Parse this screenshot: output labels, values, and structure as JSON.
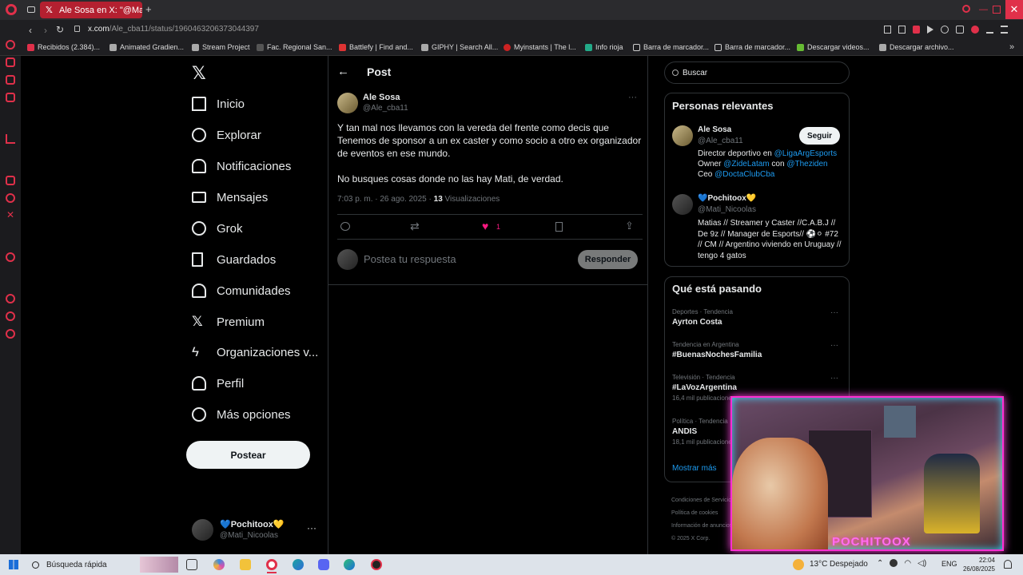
{
  "browser": {
    "tab_title": "Ale Sosa en X: \"@Mati_Ni...",
    "url_prefix": "x.com",
    "url_path": "/Ale_cba11/status/1960463206373044397",
    "bookmarks": [
      "Recibidos (2.384)...",
      "Animated Gradien...",
      "Stream Project",
      "Fac. Regional San...",
      "Battlefy | Find and...",
      "GIPHY | Search All...",
      "Myinstants | The l...",
      "Info rioja",
      "Barra de marcador...",
      "Barra de marcador...",
      "Descargar videos...",
      "Descargar archivo..."
    ]
  },
  "sidebar": {
    "items": [
      {
        "label": "Inicio"
      },
      {
        "label": "Explorar"
      },
      {
        "label": "Notificaciones"
      },
      {
        "label": "Mensajes"
      },
      {
        "label": "Grok"
      },
      {
        "label": "Guardados"
      },
      {
        "label": "Comunidades"
      },
      {
        "label": "Premium"
      },
      {
        "label": "Organizaciones v..."
      },
      {
        "label": "Perfil"
      },
      {
        "label": "Más opciones"
      }
    ],
    "post_button": "Postear",
    "account_name": "💙Pochitoox💛",
    "account_handle": "@Mati_Nicoolas"
  },
  "post": {
    "header": "Post",
    "author_name": "Ale Sosa",
    "author_handle": "@Ale_cba11",
    "text_p1": "Y tan mal nos llevamos con la vereda del frente como decis que Tenemos de sponsor a un ex caster y como socio a otro ex organizador de eventos en ese mundo.",
    "text_p2": "No busques cosas donde no las hay Mati, de verdad.",
    "time": "7:03 p. m. · 26 ago. 2025 · ",
    "views_count": "13",
    "views_label": " Visualizaciones",
    "like_count": "1",
    "reply_placeholder": "Postea tu respuesta",
    "reply_button": "Responder"
  },
  "right": {
    "search_placeholder": "Buscar",
    "relevant_title": "Personas relevantes",
    "person1": {
      "name": "Ale Sosa",
      "handle": "@Ale_cba11",
      "follow": "Seguir",
      "bio_l1_a": "Director deportivo en ",
      "bio_l1_link": "@LigaArgEsports",
      "bio_l2_a": "Owner ",
      "bio_l2_link1": "@ZideLatam",
      "bio_l2_b": " con ",
      "bio_l2_link2": "@Theziden",
      "bio_l3_a": "Ceo ",
      "bio_l3_link": "@DoctaClubCba"
    },
    "person2": {
      "name": "💙Pochitoox💛",
      "handle": "@Mati_Nicoolas",
      "bio": "Matias // Streamer y Caster //C.A.B.J // De 9z // Manager de Esports// ⚽⚪ #72 // CM // Argentino viviendo en Uruguay // tengo 4 gatos"
    },
    "trends_title": "Qué está pasando",
    "trends": [
      {
        "meta": "Deportes · Tendencia",
        "name": "Ayrton Costa",
        "posts": ""
      },
      {
        "meta": "Tendencia en Argentina",
        "name": "#BuenasNochesFamilia",
        "posts": ""
      },
      {
        "meta": "Televisión · Tendencia",
        "name": "#LaVozArgentina",
        "posts": "16,4 mil publicaciones"
      },
      {
        "meta": "Política · Tendencia",
        "name": "ANDIS",
        "posts": "18,1 mil publicaciones"
      }
    ],
    "show_more": "Mostrar más",
    "footer_l1": "Condiciones de Servicio",
    "footer_l2": "Política de cookies",
    "footer_l3": "Información de anuncios",
    "footer_l4": "© 2025 X Corp."
  },
  "webcam": {
    "overlay_text": "POCHITOOX"
  },
  "taskbar": {
    "search_placeholder": "Búsqueda rápida",
    "weather_temp": "13°C",
    "weather_desc": "Despejado",
    "lang": "ENG",
    "time": "22:04",
    "date": "26/08/2025"
  },
  "colors": {
    "accent": "#1d9bf0",
    "like": "#f91880",
    "browser_red": "#b42030",
    "cam_border": "#ff2fd2"
  }
}
